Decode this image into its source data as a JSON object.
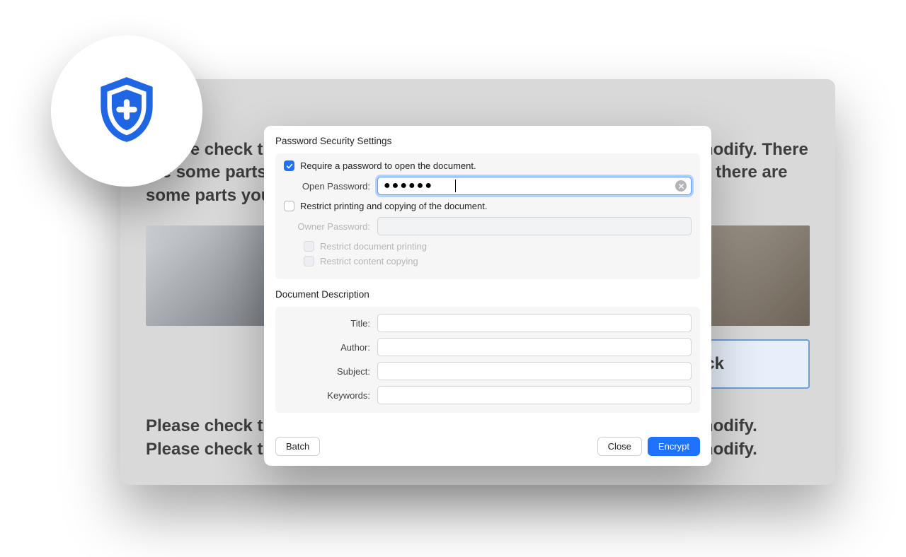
{
  "badge": {
    "icon": "shield-plus-icon",
    "color": "#1f66e5"
  },
  "background": {
    "top_text": "Please check this design drawing, there are some parts you need to modify. There are some parts you need to modify. Please check this design drawing, there are some parts you need to modify.",
    "bottom_text": "Please check this design drawing, there are some parts you need to modify. Please check this design drawing, there are some parts you need to modify.",
    "check_button": "check"
  },
  "dialog": {
    "security": {
      "title": "Password Security Settings",
      "require_pw_label": "Require a password to open the document.",
      "require_pw_checked": true,
      "open_pw_label": "Open Password:",
      "open_pw_value": "●●●●●●",
      "restrict_label": "Restrict printing and copying of the document.",
      "restrict_checked": false,
      "owner_pw_label": "Owner Password:",
      "owner_pw_value": "",
      "restrict_printing_label": "Restrict document printing",
      "restrict_copying_label": "Restrict content copying"
    },
    "description": {
      "title": "Document Description",
      "title_label": "Title:",
      "title_value": "",
      "author_label": "Author:",
      "author_value": "",
      "subject_label": "Subject:",
      "subject_value": "",
      "keywords_label": "Keywords:",
      "keywords_value": ""
    },
    "buttons": {
      "batch": "Batch",
      "close": "Close",
      "encrypt": "Encrypt"
    }
  }
}
